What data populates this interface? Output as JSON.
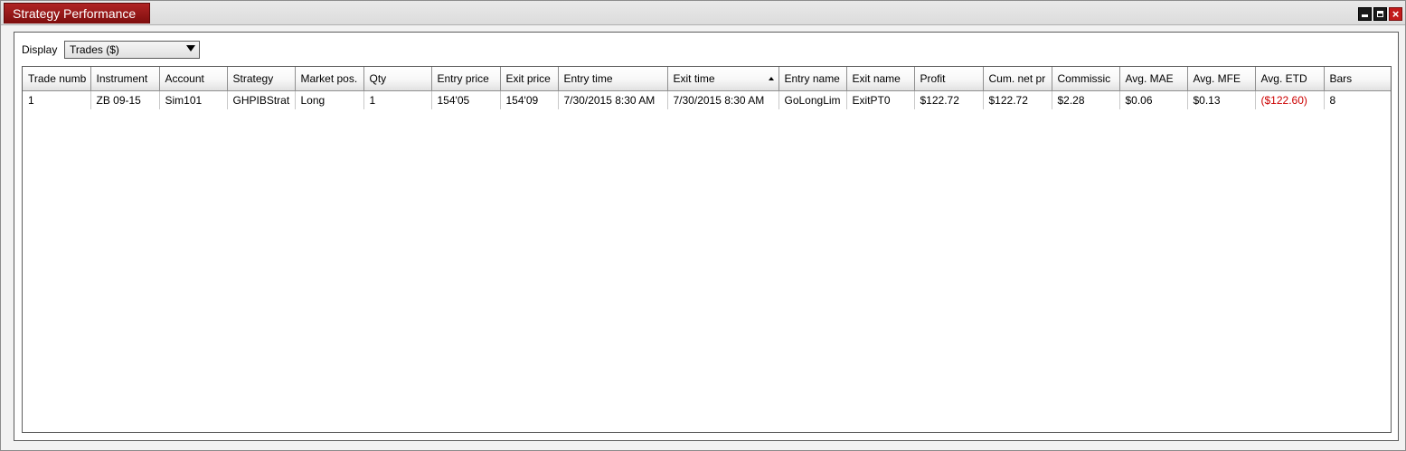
{
  "window": {
    "title": "Strategy Performance",
    "close_glyph": "×",
    "buttons": [
      "minimize-icon",
      "maximize-icon",
      "close-icon"
    ]
  },
  "display": {
    "label": "Display",
    "selected": "Trades ($)"
  },
  "table": {
    "sorted_column": "Exit time",
    "sort_direction": "ascending",
    "negative_color": "#cc0000",
    "columns": [
      "Trade numb",
      "Instrument",
      "Account",
      "Strategy",
      "Market pos.",
      "Qty",
      "Entry price",
      "Exit price",
      "Entry time",
      "Exit time",
      "Entry name",
      "Exit name",
      "Profit",
      "Cum. net pr",
      "Commissic",
      "Avg. MAE",
      "Avg. MFE",
      "Avg. ETD",
      "Bars"
    ],
    "rows": [
      {
        "cells": [
          "1",
          "ZB 09-15",
          "Sim101",
          "GHPIBStrat",
          "Long",
          "1",
          "154'05",
          "154'09",
          "7/30/2015 8:30 AM",
          "7/30/2015 8:30 AM",
          "GoLongLim",
          "ExitPT0",
          "$122.72",
          "$122.72",
          "$2.28",
          "$0.06",
          "$0.13",
          "($122.60)",
          "8"
        ]
      }
    ]
  }
}
